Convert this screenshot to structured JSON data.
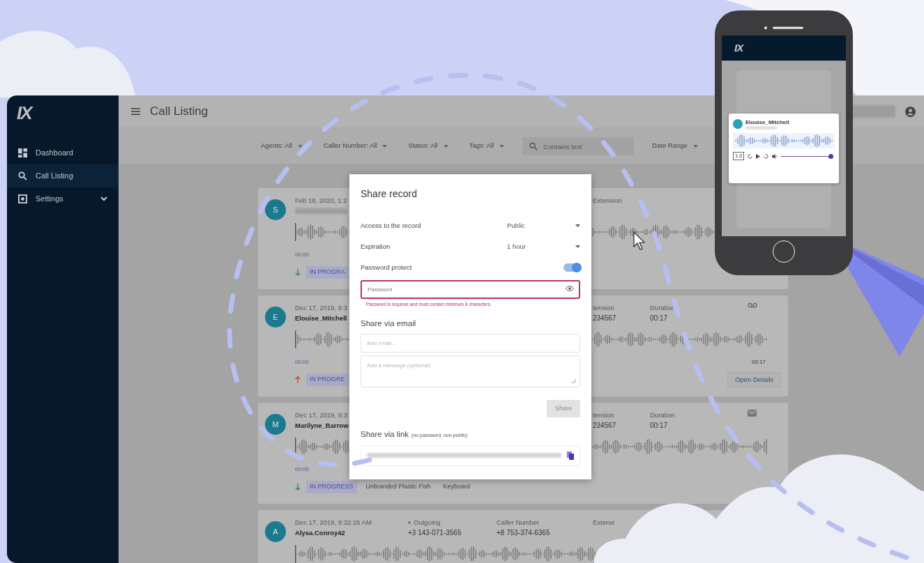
{
  "logo": "IX",
  "sidebar": {
    "items": [
      {
        "label": "Dashboard",
        "kind": "dashboard",
        "selected": false,
        "has_submenu": false
      },
      {
        "label": "Call Listing",
        "kind": "search",
        "selected": true,
        "has_submenu": false
      },
      {
        "label": "Settings",
        "kind": "settings",
        "selected": false,
        "has_submenu": true
      }
    ]
  },
  "header": {
    "title": "Call Listing"
  },
  "filters": [
    {
      "kind": "dropdown",
      "label": "Agents: All"
    },
    {
      "kind": "dropdown",
      "label": "Caller Number: All"
    },
    {
      "kind": "dropdown",
      "label": "Status: All"
    },
    {
      "kind": "dropdown",
      "label": "Tags: All"
    },
    {
      "kind": "search",
      "placeholder": "Contains text"
    },
    {
      "kind": "dropdown",
      "label": "Date Range"
    }
  ],
  "calls": [
    {
      "initial": "S",
      "date": "Feb 18, 2020, 1:2",
      "name_blurred": true,
      "time": "00:00",
      "incoming": true,
      "extension_label": "Extension",
      "tags": [
        {
          "label": "IN PROGRA",
          "kind": "status"
        }
      ]
    },
    {
      "kind": "voicemail",
      "initial": "E",
      "date": "Dec 17, 2019, 9:3",
      "name": "Elouise_Mitchell",
      "time": "00:00",
      "incoming": false,
      "extension_label": "tension",
      "extension": "234567",
      "duration_label": "Duration",
      "duration": "00:17",
      "end_time": "00:17",
      "button": "Open Details",
      "tags": [
        {
          "label": "IN PROGRE",
          "kind": "status"
        }
      ]
    },
    {
      "kind": "mail",
      "initial": "M",
      "date": "Dec 17, 2019, 9:3",
      "name": "Marilyne_Barrow",
      "time": "00:00",
      "incoming": true,
      "extension_label": "tension",
      "extension": "234567",
      "duration_label": "Duration",
      "duration": "00:17",
      "tags": [
        {
          "label": "IN PROGRESS",
          "kind": "status"
        },
        {
          "label": "Unbranded Plastic Fish",
          "kind": "plain"
        },
        {
          "label": "Keyboard",
          "kind": "plain"
        }
      ]
    },
    {
      "initial": "A",
      "date": "Dec 17, 2019, 9:32:26 AM",
      "name": "Alysa.Conroy42",
      "type_label": "Outgoing",
      "number": "+3 143-071-3565",
      "caller_label": "Caller Number",
      "caller_number": "+8 753-374-6365",
      "extension_label": "Extensi"
    }
  ],
  "share_dialog": {
    "title": "Share record",
    "settings": [
      {
        "label": "Access to the record",
        "value": "Public"
      },
      {
        "label": "Expiration",
        "value": "1 hour"
      }
    ],
    "password_protect": {
      "label": "Password protect",
      "on": true
    },
    "password": {
      "placeholder": "Password",
      "invalid": true,
      "error": "Password is required and must contain minimum 8 characters."
    },
    "email_heading": "Share via email",
    "email": {
      "placeholder": "Add email..."
    },
    "message": {
      "placeholder": "Add a message (optional)"
    },
    "share_button": {
      "label": "Share",
      "disabled": true
    },
    "link_heading": "Share via link",
    "link_note": "(no password, non-public)"
  },
  "phone": {
    "logo": "IX",
    "card": {
      "name": "Elouise_Mitchell",
      "speed": "1.0",
      "volume": {
        "level": 1
      }
    }
  }
}
